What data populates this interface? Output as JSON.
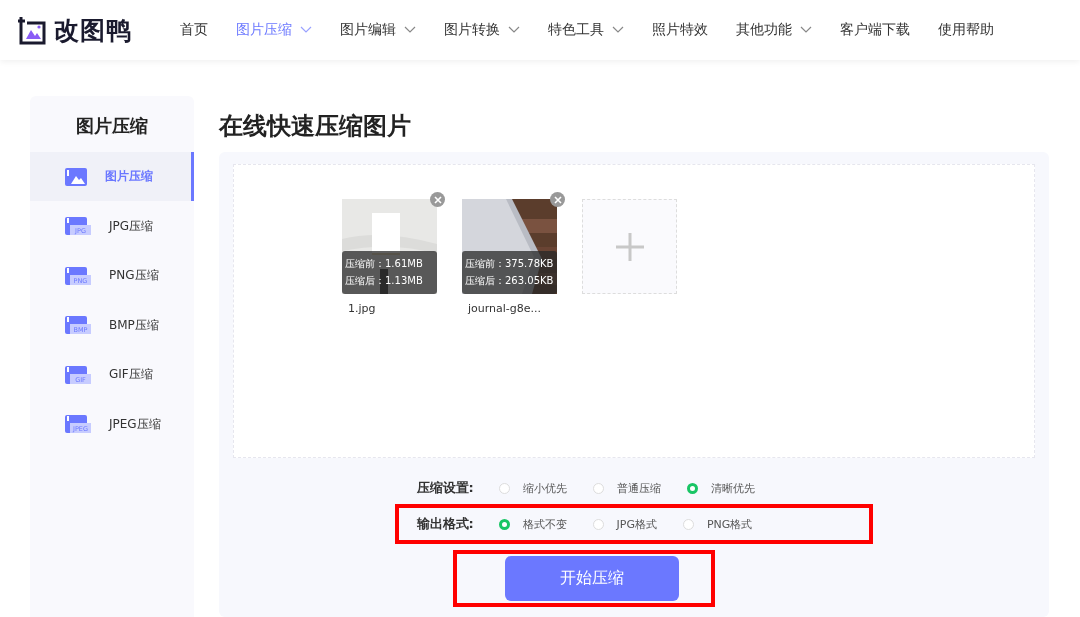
{
  "header": {
    "logo": "改图鸭",
    "nav": [
      {
        "label": "首页",
        "selected": false,
        "dropdown": false
      },
      {
        "label": "图片压缩",
        "selected": true,
        "dropdown": true
      },
      {
        "label": "图片编辑",
        "selected": false,
        "dropdown": true
      },
      {
        "label": "图片转换",
        "selected": false,
        "dropdown": true
      },
      {
        "label": "特色工具",
        "selected": false,
        "dropdown": true
      },
      {
        "label": "照片特效",
        "selected": false,
        "dropdown": false
      },
      {
        "label": "其他功能",
        "selected": false,
        "dropdown": true
      },
      {
        "label": "客户端下载",
        "selected": false,
        "dropdown": false
      },
      {
        "label": "使用帮助",
        "selected": false,
        "dropdown": false
      }
    ]
  },
  "sidebar": {
    "title": "图片压缩",
    "items": [
      {
        "label": "图片压缩",
        "selected": true
      },
      {
        "label": "JPG压缩",
        "badge": "JPG",
        "selected": false
      },
      {
        "label": "PNG压缩",
        "badge": "PNG",
        "selected": false
      },
      {
        "label": "BMP压缩",
        "badge": "BMP",
        "selected": false
      },
      {
        "label": "GIF压缩",
        "badge": "GIF",
        "selected": false
      },
      {
        "label": "JPEG压缩",
        "badge": "JPEG",
        "selected": false
      }
    ]
  },
  "main": {
    "title": "在线快速压缩图片",
    "files": [
      {
        "name": "1.jpg",
        "before": "压缩前：1.61MB",
        "after": "压缩后：1.13MB"
      },
      {
        "name": "journal-g8e...",
        "before": "压缩前：375.78KB",
        "after": "压缩后：263.05KB"
      }
    ],
    "settings": [
      {
        "label": "压缩设置:",
        "highlighted": false,
        "options": [
          {
            "label": "缩小优先",
            "selected": false
          },
          {
            "label": "普通压缩",
            "selected": false
          },
          {
            "label": "清晰优先",
            "selected": true
          }
        ]
      },
      {
        "label": "输出格式:",
        "highlighted": true,
        "options": [
          {
            "label": "格式不变",
            "selected": true
          },
          {
            "label": "JPG格式",
            "selected": false
          },
          {
            "label": "PNG格式",
            "selected": false
          }
        ]
      }
    ],
    "start_button": {
      "label": "开始压缩",
      "highlighted": true
    }
  }
}
